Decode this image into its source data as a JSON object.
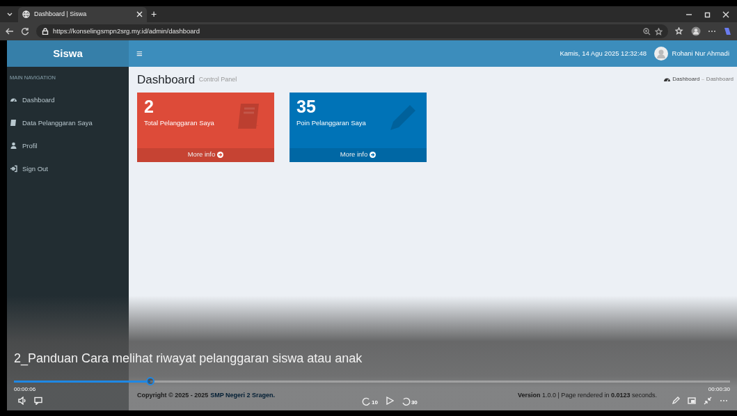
{
  "browser": {
    "tab": {
      "title": "Dashboard | Siswa",
      "selected": true
    },
    "new_tab": "+",
    "url": "https://konselingsmpn2srg.my.id/admin/dashboard"
  },
  "app": {
    "brand": "Siswa",
    "menu": "≡",
    "datetime": "Kamis, 14 Agu 2025 12:32:48",
    "user": "Rohani Nur Ahmadi"
  },
  "sidebar": {
    "header": "MAIN NAVIGATION",
    "items": [
      {
        "label": "Dashboard"
      },
      {
        "label": "Data Pelanggaran Saya"
      },
      {
        "label": "Profil"
      },
      {
        "label": "Sign Out"
      }
    ]
  },
  "page": {
    "title": "Dashboard",
    "subtitle": "Control Panel",
    "breadcrumb": [
      "Dashboard",
      "Dashboard"
    ]
  },
  "boxes": [
    {
      "value": "2",
      "label": "Total Pelanggaran Saya",
      "link": "More info",
      "color": "#dd4b39"
    },
    {
      "value": "35",
      "label": "Poin Pelanggaran Saya",
      "link": "More info",
      "color": "#0073b7"
    }
  ],
  "footer": {
    "copyright": "Copyright © 2025 - 2025",
    "school": "SMP Negeri 2 Sragen.",
    "version": "**Version** 1.0.0 | Page rendered in **0.0123** seconds."
  },
  "video": {
    "caption": "2_Panduan Cara melihat riwayat pelanggaran siswa atau anak",
    "elapsed": "00:00:06",
    "duration": "00:00:30",
    "level": 0.19,
    "rewind": "10",
    "forward": "30"
  }
}
